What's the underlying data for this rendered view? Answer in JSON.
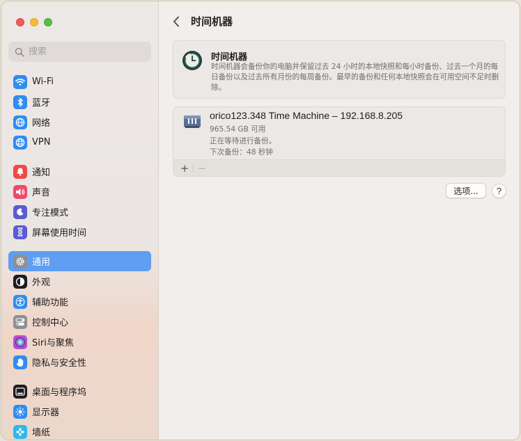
{
  "window": {
    "lights": [
      "close",
      "minimize",
      "zoom"
    ]
  },
  "sidebar": {
    "search_placeholder": "搜索",
    "groups": [
      [
        {
          "key": "wifi",
          "label": "Wi-Fi",
          "icon": "wifi-icon",
          "color": "#2f8cf1"
        },
        {
          "key": "bluetooth",
          "label": "蓝牙",
          "icon": "bluetooth-icon",
          "color": "#2f8cf1"
        },
        {
          "key": "network",
          "label": "网络",
          "icon": "globe-icon",
          "color": "#2f8cf1"
        },
        {
          "key": "vpn",
          "label": "VPN",
          "icon": "vpn-globe-icon",
          "color": "#2f8cf1"
        }
      ],
      [
        {
          "key": "notifications",
          "label": "通知",
          "icon": "bell-icon",
          "color": "#ef4a45"
        },
        {
          "key": "sound",
          "label": "声音",
          "icon": "speaker-icon",
          "color": "#ef4a6c"
        },
        {
          "key": "focus",
          "label": "专注模式",
          "icon": "moon-icon",
          "color": "#5b5bd6"
        },
        {
          "key": "screentime",
          "label": "屏幕使用时间",
          "icon": "hourglass-icon",
          "color": "#5b5bd6"
        }
      ],
      [
        {
          "key": "general",
          "label": "通用",
          "icon": "gear-icon",
          "color": "#8e8e93",
          "active": true
        },
        {
          "key": "appearance",
          "label": "外观",
          "icon": "appearance-icon",
          "color": "#1d1d1f"
        },
        {
          "key": "accessibility",
          "label": "辅助功能",
          "icon": "accessibility-icon",
          "color": "#2f8cf1"
        },
        {
          "key": "control_center",
          "label": "控制中心",
          "icon": "switches-icon",
          "color": "#8e8e93"
        },
        {
          "key": "siri",
          "label": "Siri与聚焦",
          "icon": "siri-icon",
          "color": "#b04fd9"
        },
        {
          "key": "privacy",
          "label": "隐私与安全性",
          "icon": "hand-icon",
          "color": "#2f8cf1"
        }
      ],
      [
        {
          "key": "desktop",
          "label": "桌面与程序坞",
          "icon": "dock-icon",
          "color": "#1d1d1f"
        },
        {
          "key": "displays",
          "label": "显示器",
          "icon": "sun-icon",
          "color": "#2f8cf1"
        },
        {
          "key": "wallpaper",
          "label": "墙纸",
          "icon": "flower-icon",
          "color": "#2fb8e8"
        }
      ]
    ]
  },
  "main": {
    "title": "时间机器",
    "info": {
      "title": "时间机器",
      "description": "时间机器会备份你的电脑并保留过去 24 小时的本地快照和每小时备份、过去一个月的每日备份以及过去所有月份的每周备份。最早的备份和任何本地快照会在可用空间不足时删除。"
    },
    "disk": {
      "name": "orico123.348 Time Machine – 192.168.8.205",
      "available": "965.54 GB 可用",
      "status": "正在等待进行备份。",
      "next": "下次备份：48 秒钟"
    },
    "toolbar": {
      "add": "+",
      "remove": "−"
    },
    "options_label": "选项...",
    "help_label": "?"
  }
}
